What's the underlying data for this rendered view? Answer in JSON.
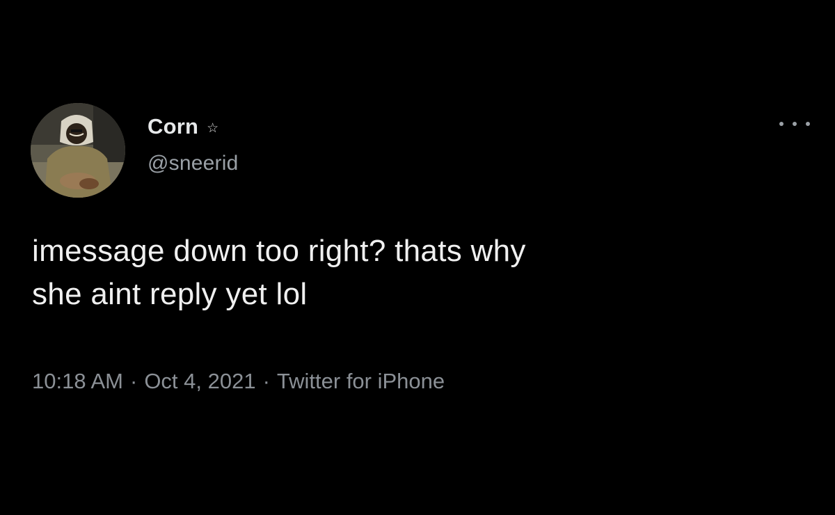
{
  "author": {
    "display_name": "Corn",
    "name_emoji": "☆",
    "handle": "@sneerid"
  },
  "tweet": {
    "text_lines": [
      "imessage down too right? thats why",
      "she aint reply yet lol"
    ]
  },
  "meta": {
    "time": "10:18 AM",
    "separator": "·",
    "date": "Oct 4, 2021",
    "source": "Twitter for iPhone"
  },
  "icons": {
    "more": "more-horizontal-icon",
    "emoji": "star-icon"
  },
  "colors": {
    "background": "#000000",
    "text_primary": "#e7e9ea",
    "text_secondary": "#8b9096"
  }
}
